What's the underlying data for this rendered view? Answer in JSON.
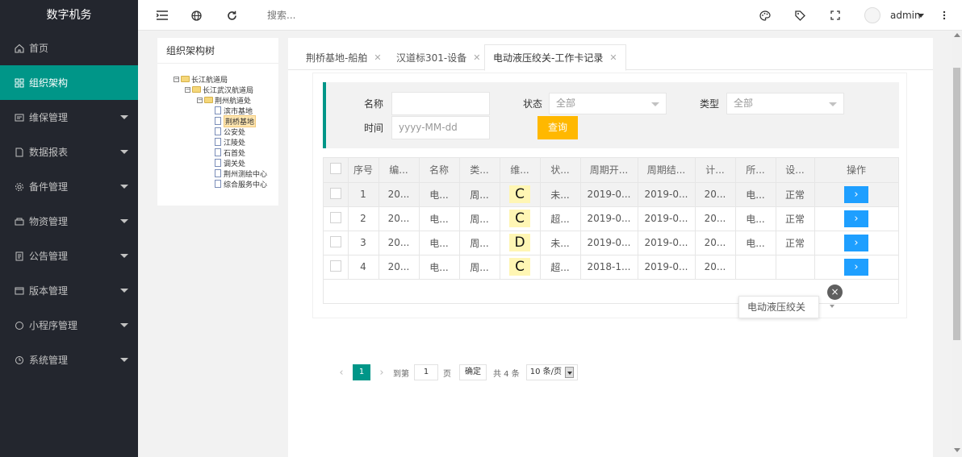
{
  "app": {
    "title": "数字机务"
  },
  "sidebar": {
    "items": [
      {
        "label": "首页",
        "icon": "home-icon",
        "active": false,
        "has_children": false
      },
      {
        "label": "组织架构",
        "icon": "org-structure-icon",
        "active": true,
        "has_children": false
      },
      {
        "label": "维保管理",
        "icon": "maintenance-icon",
        "active": false,
        "has_children": true
      },
      {
        "label": "数据报表",
        "icon": "report-icon",
        "active": false,
        "has_children": true
      },
      {
        "label": "备件管理",
        "icon": "gear-icon",
        "active": false,
        "has_children": true
      },
      {
        "label": "物资管理",
        "icon": "material-icon",
        "active": false,
        "has_children": true
      },
      {
        "label": "公告管理",
        "icon": "notice-icon",
        "active": false,
        "has_children": true
      },
      {
        "label": "版本管理",
        "icon": "version-icon",
        "active": false,
        "has_children": true
      },
      {
        "label": "小程序管理",
        "icon": "mini-program-icon",
        "active": false,
        "has_children": true
      },
      {
        "label": "系统管理",
        "icon": "system-icon",
        "active": false,
        "has_children": true
      }
    ]
  },
  "header": {
    "search_placeholder": "搜索...",
    "user": "admin",
    "icons": [
      "menu-toggle-icon",
      "globe-icon",
      "refresh-icon",
      "theme-icon",
      "tag-icon",
      "fullscreen-icon",
      "more-icon"
    ]
  },
  "org_tree": {
    "title": "组织架构树",
    "nodes": [
      {
        "label": "长江航道局",
        "type": "folder",
        "level": 0
      },
      {
        "label": "长江武汉航道局",
        "type": "folder",
        "level": 1
      },
      {
        "label": "荆州航道处",
        "type": "folder",
        "level": 2
      },
      {
        "label": "滨市基地",
        "type": "doc",
        "level": 3
      },
      {
        "label": "荆桥基地",
        "type": "doc",
        "level": 3,
        "selected": true
      },
      {
        "label": "公安处",
        "type": "doc",
        "level": 3
      },
      {
        "label": "江陵处",
        "type": "doc",
        "level": 3
      },
      {
        "label": "石首处",
        "type": "doc",
        "level": 3
      },
      {
        "label": "调关处",
        "type": "doc",
        "level": 3
      },
      {
        "label": "荆州测绘中心",
        "type": "doc",
        "level": 3
      },
      {
        "label": "综合服务中心",
        "type": "doc",
        "level": 3
      }
    ]
  },
  "tabs": [
    {
      "label": "荆桥基地-船舶",
      "active": false
    },
    {
      "label": "汉道标301-设备",
      "active": false
    },
    {
      "label": "电动液压绞关-工作卡记录",
      "active": true
    }
  ],
  "filters": {
    "name_label": "名称",
    "name_value": "",
    "status_label": "状态",
    "status_value": "全部",
    "type_label": "类型",
    "type_value": "全部",
    "time_label": "时间",
    "time_placeholder": "yyyy-MM-dd",
    "query_label": "查询"
  },
  "table": {
    "headers": [
      "序号",
      "编...",
      "名称",
      "类...",
      "维...",
      "状...",
      "周期开...",
      "周期结...",
      "计...",
      "所...",
      "设...",
      "操作"
    ],
    "rows": [
      [
        "1",
        "20...",
        "电...",
        "周...",
        "C",
        "未...",
        "2019-0...",
        "2019-0...",
        "20...",
        "电...",
        "正常"
      ],
      [
        "2",
        "20...",
        "电...",
        "周...",
        "C",
        "超...",
        "2019-0...",
        "2019-0...",
        "20...",
        "电...",
        "正常"
      ],
      [
        "3",
        "20...",
        "电...",
        "周...",
        "D",
        "未...",
        "2019-0...",
        "2019-0...",
        "20...",
        "电...",
        "正常"
      ],
      [
        "4",
        "20...",
        "电...",
        "周...",
        "C",
        "超...",
        "2018-1...",
        "2019-0...",
        "20...",
        "",
        ""
      ]
    ],
    "action_label": "›",
    "tooltip": "电动液压绞关",
    "tooltip_close": "×"
  },
  "pagination": {
    "prev": "‹",
    "current_page": "1",
    "next": "›",
    "goto_label": "到第",
    "goto_value": "1",
    "page_unit": "页",
    "confirm_label": "确定",
    "total_label": "共 4 条",
    "page_size": "10 条/页"
  },
  "colors": {
    "sidebar_bg": "#23262e",
    "accent": "#009688",
    "query_button": "#ffb800",
    "action_button": "#1e9fff",
    "grade_bg": "#fff6b4"
  }
}
